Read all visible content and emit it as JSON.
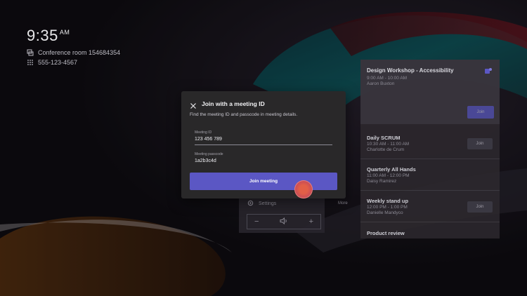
{
  "clock": {
    "time": "9:35",
    "ampm": "AM"
  },
  "room": {
    "name": "Conference room 154684354",
    "phone": "555-123-4567"
  },
  "icons": {
    "room": "room-icon",
    "dialpad": "dialpad-icon",
    "close": "close-icon",
    "teams": "teams-logo-icon",
    "settings": "gear-icon",
    "volume": "speaker-icon",
    "minus": "minus-icon",
    "plus": "plus-icon"
  },
  "colors": {
    "accent": "#5b57c4",
    "dialog_bg": "#292829",
    "touch": "#e25f47"
  },
  "meetings": [
    {
      "title": "Design Workshop - Accessibility",
      "time": "9:00 AM - 10:00 AM",
      "organizer": "Aaron Buxton",
      "join": "Join"
    },
    {
      "title": "Daily SCRUM",
      "time": "10:30 AM - 11:00 AM",
      "organizer": "Charlotte de Crum",
      "join": "Join"
    },
    {
      "title": "Quarterly All Hands",
      "time": "11:00 AM - 12:00 PM",
      "organizer": "Daisy Ramirez",
      "join": ""
    },
    {
      "title": "Weekly stand up",
      "time": "12:00 PM - 1:00 PM",
      "organizer": "Danielle Mandyco",
      "join": "Join"
    },
    {
      "title": "Product review",
      "time": "",
      "organizer": "",
      "join": ""
    }
  ],
  "controls": {
    "settings": "Settings",
    "more": "More",
    "minus": "−",
    "plus": "+"
  },
  "dialog": {
    "title": "Join with a meeting ID",
    "description": "Find the meeting ID and passcode in meeting details.",
    "meeting_id_label": "Meeting ID",
    "meeting_id_value": "123 456 789",
    "passcode_label": "Meeting passcode",
    "passcode_value": "1a2b3c4d",
    "join_button": "Join meeting"
  }
}
